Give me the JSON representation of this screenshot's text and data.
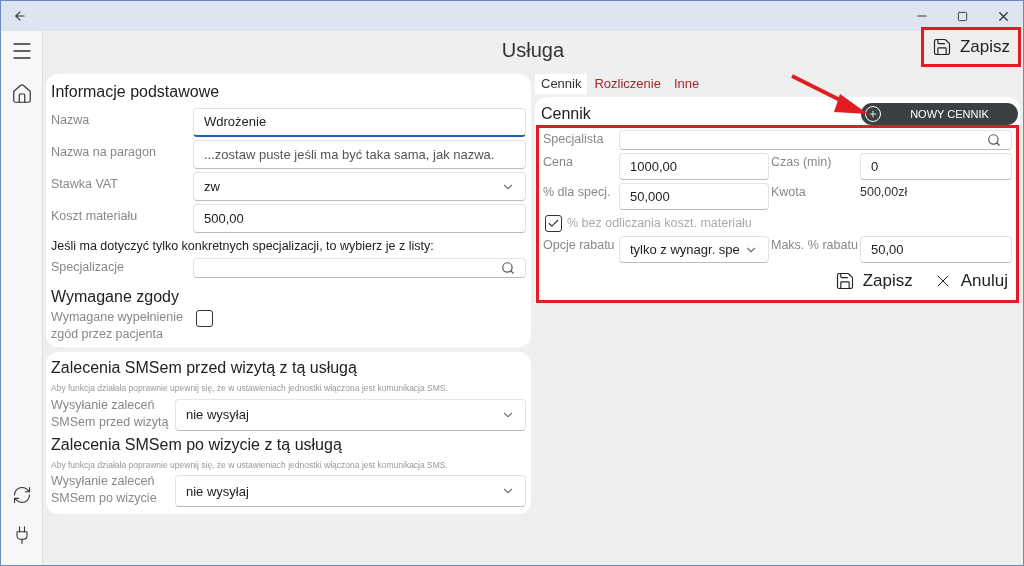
{
  "header": {
    "title": "Usługa",
    "save_button": "Zapisz"
  },
  "basic_info": {
    "title": "Informacje podstawowe",
    "fields": [
      {
        "kind": "text",
        "label": "Nazwa",
        "value": "Wdrożenie",
        "focused": true
      },
      {
        "kind": "text",
        "label": "Nazwa na paragon",
        "placeholder": "...zostaw puste jeśli ma być taka sama, jak nazwa.",
        "focused": false
      },
      {
        "kind": "select",
        "label": "Stawka VAT",
        "value": "zw",
        "focused": false
      },
      {
        "kind": "text",
        "label": "Koszt materiału",
        "value": "500,00",
        "focused": false
      }
    ],
    "hint": "Jeśli ma dotyczyć tylko konkretnych specjalizacji, to wybierz je z listy:",
    "search_label": "Specjalizacje"
  },
  "consents": {
    "title": "Wymagane zgody",
    "label": "Wymagane wypełnienie zgód przez pacjenta",
    "checked": false
  },
  "sms": [
    {
      "title": "Zalecenia SMSem przed wizytą z tą usługą",
      "note": "Aby funkcja działała poprawnie upewnij się, że w ustawieniach jednostki włączona jest komunikacja SMS.",
      "label": "Wysyłanie zaleceń SMSem przed wizytą",
      "value": "nie wysyłaj"
    },
    {
      "title": "Zalecenia SMSem po wizycie z tą usługą",
      "note": "Aby funkcja działała poprawnie upewnij się, że w ustawieniach jednostki włączona jest komunikacja SMS.",
      "label": "Wysyłanie zaleceń SMSem po wizycie",
      "value": "nie wysyłaj"
    }
  ],
  "tabs": [
    {
      "label": "Cennik",
      "selected": true
    },
    {
      "label": "Rozliczenie",
      "selected": false
    },
    {
      "label": "Inne",
      "selected": false
    }
  ],
  "pricing": {
    "title": "Cennik",
    "new_button": "NOWY CENNIK",
    "specialist_label": "Specjalista",
    "price_label": "Cena",
    "price": "1000,00",
    "time_label": "Czas (min)",
    "time": "0",
    "percent_label": "% dla specj.",
    "percent": "50,000",
    "amount_label": "Kwota",
    "amount": "500,00zł",
    "no_deduct": {
      "label": "% bez odliczania koszt. materiału",
      "checked": true
    },
    "discount_label": "Opcje rabatu",
    "discount": "tylko z wynagr. spe",
    "max_label": "Maks. % rabatu",
    "max": "50,00",
    "save": "Zapisz",
    "cancel": "Anuluj"
  }
}
